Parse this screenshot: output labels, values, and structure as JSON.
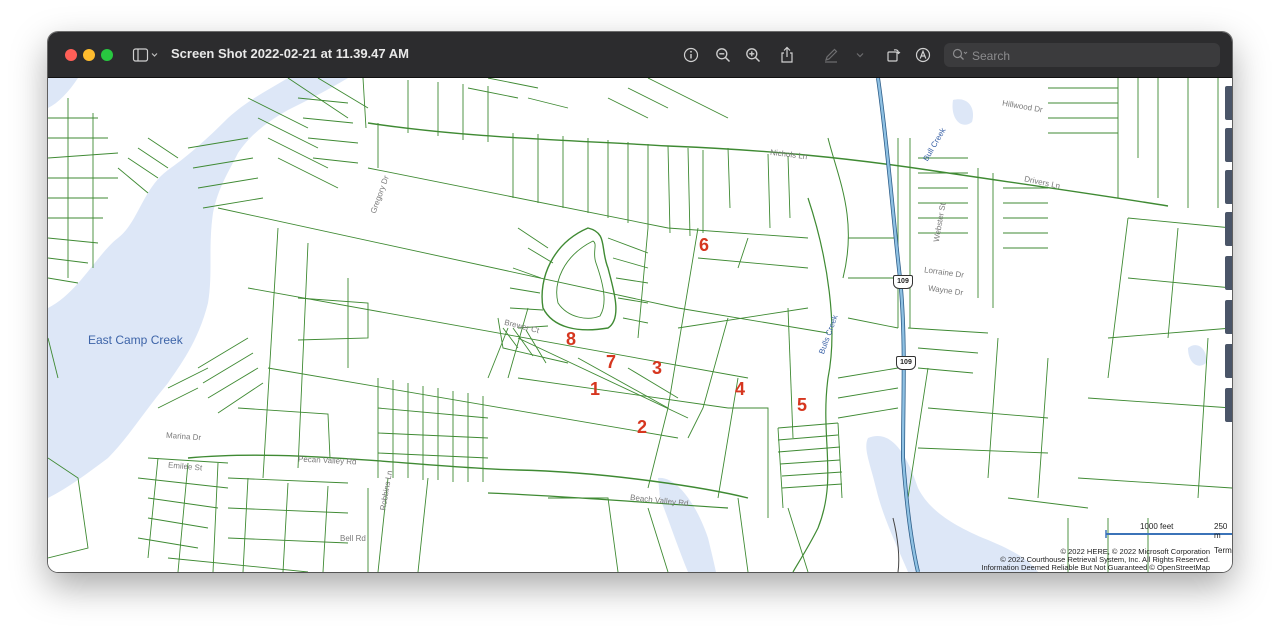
{
  "window": {
    "title": "Screen Shot 2022-02-21 at 11.39.47 AM",
    "search_placeholder": "Search"
  },
  "toolbar": {
    "icons": [
      "sidebar-icon",
      "chevron-down-icon",
      "info-icon",
      "zoom-out-icon",
      "zoom-in-icon",
      "share-icon",
      "markup-pen-icon",
      "chevron-down-icon",
      "rotate-icon",
      "annotate-icon",
      "search-icon"
    ]
  },
  "map": {
    "water_label": "East Camp Creek",
    "road_labels": {
      "nichols": "Nichols Ln",
      "beach_valley": "Beach Valley Rd",
      "pecan_valley": "Pecan Valley Rd",
      "marina": "Marina Dr",
      "emilee": "Emilee St",
      "bell": "Bell Rd",
      "brewer": "Brewer Ct",
      "bulls_creek": "Bulls Creek",
      "webster": "Webster St",
      "lorraine": "Lorraine Dr",
      "wayne": "Wayne Dr",
      "drivers": "Drivers Ln",
      "upper_creek": "Bull Creek",
      "robbins": "Robbins Ln",
      "gregory": "Gregory Dr",
      "hillwood": "Hillwood Dr"
    },
    "route_shields": [
      "109",
      "109"
    ],
    "parcels": [
      "1",
      "2",
      "3",
      "4",
      "5",
      "6",
      "7",
      "8"
    ],
    "scale": {
      "label1": "1000 feet",
      "label2": "250 m"
    },
    "copyright": [
      "© 2022 HERE, © 2022 Microsoft Corporation",
      "© 2022 Courthouse Retrieval System, Inc. All Rights Reserved.",
      "Information Deemed Reliable But Not Guaranteed © OpenStreetMap"
    ],
    "terms": "Terms",
    "colors": {
      "water": "#dde7f7",
      "parcel_lines": "#3f8a33",
      "parcel_numbers": "#d6361f",
      "highway": "#7fb3d9"
    }
  }
}
